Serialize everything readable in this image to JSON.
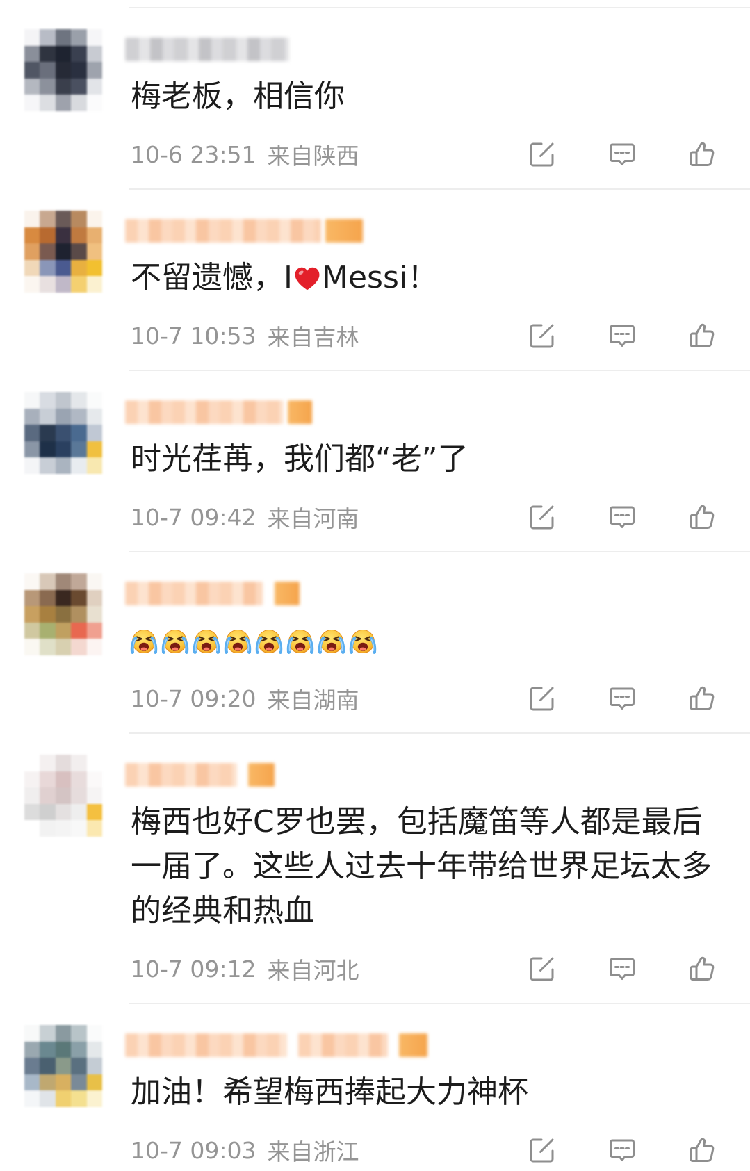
{
  "theme": {
    "background": "#ffffff",
    "text_color": "#1c1c1c",
    "meta_color": "#959595",
    "icon_color": "#8e8e8e",
    "divider_color": "#ededed",
    "heart_color": "#e3202a"
  },
  "action_icons": {
    "repost": "repost-icon",
    "comment": "comment-icon",
    "like": "like-icon"
  },
  "comments": [
    {
      "text": "梅老板，相信你",
      "time": "10-6 23:51",
      "location": "来自陕西",
      "avatar_mosaic": [
        [
          "#f4f4f6",
          "#b8bcc6",
          "#6e7480",
          "#9aa0aa",
          "#f6f6f8"
        ],
        [
          "#8a8f9a",
          "#2f3440",
          "#1e2330",
          "#3a4050",
          "#c8cbd2"
        ],
        [
          "#505664",
          "#6a6f7c",
          "#262a36",
          "#2a3040",
          "#9ea3ad"
        ],
        [
          "#b4b8c0",
          "#8c919c",
          "#3a3f4c",
          "#4a5060",
          "#e2e4e8"
        ],
        [
          "#f6f6f8",
          "#dcdee2",
          "#9ea2ac",
          "#d8dade",
          "#fbfbfc"
        ]
      ]
    },
    {
      "text_segments": [
        "不留遗憾，I",
        "Messi！"
      ],
      "inline_emoji": "red-heart-emoji",
      "time": "10-7 10:53",
      "location": "来自吉林",
      "avatar_mosaic": [
        [
          "#faf3ec",
          "#c8a890",
          "#6a5a58",
          "#b88a60",
          "#fbf4ec"
        ],
        [
          "#d88a40",
          "#b86a30",
          "#3a3040",
          "#c07a40",
          "#e8b070"
        ],
        [
          "#e0a060",
          "#7a5a50",
          "#1e2230",
          "#5a4a48",
          "#f0c080"
        ],
        [
          "#f0d8b8",
          "#8a96b8",
          "#4a5a90",
          "#e8b040",
          "#f2c030"
        ],
        [
          "#fbf6f0",
          "#e8e0e0",
          "#c0b8c8",
          "#f4d070",
          "#fbf1d0"
        ]
      ]
    },
    {
      "text": "时光荏苒，我们都“老”了",
      "time": "10-7 09:42",
      "location": "来自河南",
      "avatar_mosaic": [
        [
          "#f6f7f8",
          "#d8dce2",
          "#c0c6ce",
          "#e4e7ea",
          "#fafbfb"
        ],
        [
          "#a8b0bc",
          "#c8ced6",
          "#9aa4b2",
          "#b0b8c4",
          "#e6e9ec"
        ],
        [
          "#5a6a80",
          "#2a3a50",
          "#3a5070",
          "#4a6a90",
          "#c0c8d4"
        ],
        [
          "#8a96a6",
          "#1e3048",
          "#2a4060",
          "#5a7898",
          "#f0c040"
        ],
        [
          "#f4f5f7",
          "#c8ced6",
          "#aab4c0",
          "#e8ecf0",
          "#f8e8b0"
        ]
      ]
    },
    {
      "emojis": [
        "loudly-crying-emoji",
        "loudly-crying-emoji",
        "loudly-crying-emoji",
        "loudly-crying-emoji",
        "loudly-crying-emoji",
        "loudly-crying-emoji",
        "loudly-crying-emoji",
        "loudly-crying-emoji"
      ],
      "time": "10-7 09:20",
      "location": "来自湖南",
      "avatar_mosaic": [
        [
          "#fbf8f4",
          "#d8c8b8",
          "#a08878",
          "#c0a898",
          "#faf7f3"
        ],
        [
          "#b89878",
          "#8a6a50",
          "#3a2820",
          "#6a4a30",
          "#e0d0c0"
        ],
        [
          "#c8a060",
          "#a88040",
          "#8a7040",
          "#b09060",
          "#e8e0d0"
        ],
        [
          "#d0c8a0",
          "#a8b070",
          "#c0a060",
          "#e86850",
          "#f0a090"
        ],
        [
          "#faf8f2",
          "#e0e0c8",
          "#d8d0b0",
          "#f4d8d0",
          "#fcf4f2"
        ]
      ]
    },
    {
      "text": "梅西也好C罗也罢，包括魔笛等人都是最后一届了。这些人过去十年带给世界足坛太多的经典和热血",
      "time": "10-7 09:12",
      "location": "来自河北",
      "avatar_mosaic": [
        [
          "#ffffff",
          "#f4f0f0",
          "#e4dcdc",
          "#f2eeee",
          "#ffffff"
        ],
        [
          "#f6f2f2",
          "#e8d8d8",
          "#d8c0c0",
          "#e8dcdc",
          "#fbf9f9"
        ],
        [
          "#f0eeee",
          "#e0d0d0",
          "#d4c4c4",
          "#e6dcdc",
          "#f6f4f4"
        ],
        [
          "#dcdcdc",
          "#cfcfcf",
          "#e4e0e0",
          "#eeeeee",
          "#f4c040"
        ],
        [
          "#ffffff",
          "#f2f2f2",
          "#f4f4f4",
          "#f8f8f8",
          "#fbe8b0"
        ]
      ]
    },
    {
      "text": "加油！希望梅西捧起大力神杯",
      "time": "10-7 09:03",
      "location": "来自浙江",
      "avatar_mosaic": [
        [
          "#f8f9f9",
          "#c8d0d4",
          "#8a9aa0",
          "#b8c4c8",
          "#fafbfb"
        ],
        [
          "#9aa8b0",
          "#6a8890",
          "#5a7878",
          "#8aa0a8",
          "#e4e8ea"
        ],
        [
          "#6a7c90",
          "#4a6070",
          "#8a9a8a",
          "#5a7080",
          "#c4ccd4"
        ],
        [
          "#a8b8c8",
          "#c0a870",
          "#d8b060",
          "#7a8a98",
          "#e8c048"
        ],
        [
          "#f4f6f8",
          "#e0e4e8",
          "#f0d070",
          "#f4e090",
          "#fbf2d0"
        ]
      ]
    }
  ]
}
